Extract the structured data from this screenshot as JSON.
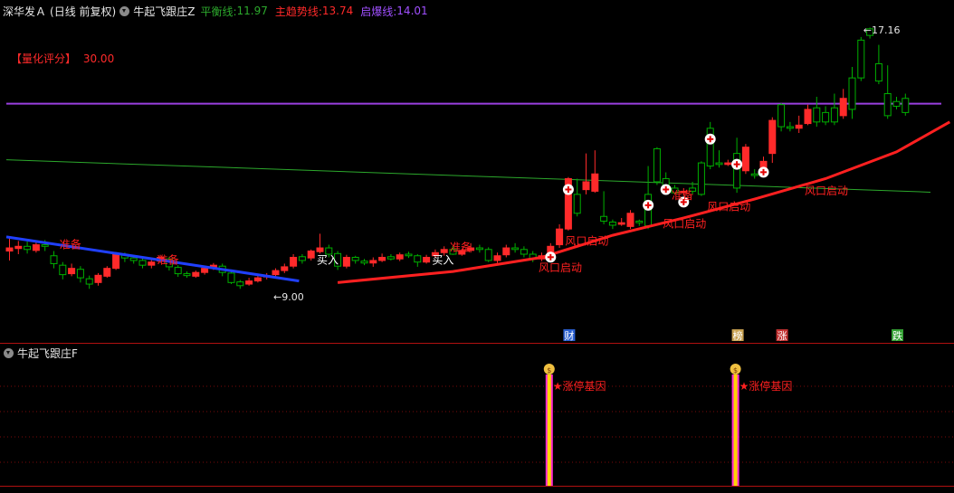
{
  "header": {
    "stock_name": "深华发Ａ",
    "period": "(日线 前复权)",
    "indicator": "牛起飞跟庄Z",
    "ma1_label": "平衡线:",
    "ma1_value": "11.97",
    "ma2_label": "主趋势线:",
    "ma2_value": "13.74",
    "ma3_label": "启爆线:",
    "ma3_value": "14.01"
  },
  "subheader": {
    "indicator": "牛起飞跟庄F"
  },
  "score": {
    "label": "【量化评分】",
    "value": "30.00"
  },
  "chart_data": {
    "type": "candlestick",
    "price_range": [
      7.5,
      17.5
    ],
    "high_label": "17.16",
    "low_label": "9.00",
    "candles": [
      [
        10.1,
        10.2,
        10.5,
        9.8
      ],
      [
        10.18,
        10.25,
        10.42,
        10.0
      ],
      [
        10.25,
        10.15,
        10.4,
        10.02
      ],
      [
        10.12,
        10.3,
        10.4,
        10.05
      ],
      [
        10.3,
        10.25,
        10.45,
        10.1
      ],
      [
        9.95,
        9.7,
        10.1,
        9.55
      ],
      [
        9.65,
        9.35,
        9.75,
        9.2
      ],
      [
        9.38,
        9.55,
        9.7,
        9.3
      ],
      [
        9.52,
        9.25,
        9.62,
        9.1
      ],
      [
        9.22,
        9.05,
        9.32,
        8.9
      ],
      [
        9.1,
        9.33,
        9.4,
        9.0
      ],
      [
        9.3,
        9.55,
        9.62,
        9.25
      ],
      [
        9.55,
        10.02,
        10.05,
        9.5
      ],
      [
        9.98,
        9.88,
        10.05,
        9.75
      ],
      [
        9.88,
        9.8,
        9.95,
        9.7
      ],
      [
        9.8,
        9.65,
        9.9,
        9.55
      ],
      [
        9.65,
        9.75,
        9.86,
        9.55
      ],
      [
        9.78,
        9.9,
        9.98,
        9.72
      ],
      [
        9.85,
        9.6,
        9.92,
        9.48
      ],
      [
        9.58,
        9.38,
        9.65,
        9.28
      ],
      [
        9.38,
        9.32,
        9.45,
        9.25
      ],
      [
        9.3,
        9.42,
        9.48,
        9.25
      ],
      [
        9.42,
        9.55,
        9.62,
        9.35
      ],
      [
        9.58,
        9.65,
        9.72,
        9.5
      ],
      [
        9.62,
        9.42,
        9.7,
        9.3
      ],
      [
        9.4,
        9.1,
        9.48,
        9.05
      ],
      [
        9.12,
        9.0,
        9.18,
        8.9
      ],
      [
        9.05,
        9.15,
        9.25,
        9.0
      ],
      [
        9.15,
        9.25,
        9.35,
        9.1
      ],
      [
        9.28,
        9.32,
        9.4,
        9.2
      ],
      [
        9.35,
        9.48,
        9.55,
        9.3
      ],
      [
        9.48,
        9.6,
        9.7,
        9.4
      ],
      [
        9.62,
        9.9,
        10.0,
        9.55
      ],
      [
        9.92,
        9.8,
        10.0,
        9.7
      ],
      [
        9.88,
        10.1,
        10.15,
        9.8
      ],
      [
        10.08,
        10.2,
        10.65,
        10.02
      ],
      [
        10.2,
        10.0,
        10.3,
        9.9
      ],
      [
        10.02,
        9.62,
        10.1,
        9.5
      ],
      [
        9.62,
        9.9,
        9.98,
        9.55
      ],
      [
        9.9,
        9.8,
        9.95,
        9.7
      ],
      [
        9.78,
        9.72,
        9.85,
        9.65
      ],
      [
        9.72,
        9.8,
        9.9,
        9.6
      ],
      [
        9.8,
        9.9,
        10.02,
        9.75
      ],
      [
        9.92,
        9.85,
        10.0,
        9.8
      ],
      [
        9.85,
        9.98,
        10.05,
        9.78
      ],
      [
        10.0,
        9.95,
        10.08,
        9.88
      ],
      [
        9.95,
        9.75,
        10.0,
        9.6
      ],
      [
        9.75,
        9.9,
        9.98,
        9.7
      ],
      [
        9.95,
        10.05,
        10.15,
        9.88
      ],
      [
        10.05,
        10.15,
        10.25,
        9.95
      ],
      [
        10.15,
        10.0,
        10.28,
        9.98
      ],
      [
        10.0,
        10.12,
        10.18,
        9.95
      ],
      [
        10.12,
        10.2,
        10.35,
        10.05
      ],
      [
        10.2,
        10.15,
        10.3,
        10.05
      ],
      [
        10.15,
        9.8,
        10.22,
        9.75
      ],
      [
        9.8,
        9.95,
        10.05,
        9.72
      ],
      [
        9.98,
        10.2,
        10.3,
        9.9
      ],
      [
        10.2,
        10.15,
        10.35,
        10.05
      ],
      [
        10.15,
        10.0,
        10.25,
        9.9
      ],
      [
        10.0,
        9.85,
        10.1,
        9.75
      ],
      [
        9.85,
        9.95,
        10.05,
        9.78
      ],
      [
        9.95,
        10.25,
        10.35,
        9.9
      ],
      [
        10.3,
        10.8,
        10.95,
        10.2
      ],
      [
        10.8,
        12.4,
        12.45,
        10.75
      ],
      [
        11.9,
        11.3,
        12.4,
        11.2
      ],
      [
        12.05,
        12.3,
        13.2,
        11.9
      ],
      [
        12.0,
        12.55,
        13.3,
        11.95
      ],
      [
        11.2,
        11.05,
        12.0,
        10.95
      ],
      [
        11.02,
        10.92,
        11.1,
        10.8
      ],
      [
        10.95,
        11.0,
        11.15,
        10.9
      ],
      [
        10.88,
        11.3,
        11.4,
        10.8
      ],
      [
        11.05,
        11.0,
        11.1,
        10.9
      ],
      [
        11.9,
        10.9,
        12.8,
        10.8
      ],
      [
        13.35,
        12.3,
        13.4,
        12.2
      ],
      [
        12.4,
        12.2,
        12.6,
        12.1
      ],
      [
        12.1,
        11.95,
        12.2,
        11.9
      ],
      [
        11.95,
        12.0,
        12.1,
        11.85
      ],
      [
        12.1,
        12.0,
        12.3,
        11.9
      ],
      [
        12.9,
        11.9,
        12.95,
        11.85
      ],
      [
        14.0,
        12.8,
        14.2,
        12.7
      ],
      [
        12.9,
        12.85,
        13.3,
        12.75
      ],
      [
        12.85,
        12.9,
        13.0,
        12.8
      ],
      [
        13.2,
        12.1,
        13.7,
        11.95
      ],
      [
        12.65,
        13.4,
        13.5,
        12.55
      ],
      [
        12.55,
        12.5,
        12.7,
        12.4
      ],
      [
        12.5,
        12.95,
        13.1,
        12.45
      ],
      [
        13.2,
        14.25,
        14.35,
        12.9
      ],
      [
        14.75,
        14.05,
        14.8,
        13.9
      ],
      [
        14.05,
        14.0,
        14.2,
        13.9
      ],
      [
        14.0,
        14.1,
        14.4,
        13.85
      ],
      [
        14.15,
        14.6,
        14.75,
        14.1
      ],
      [
        14.65,
        14.2,
        15.0,
        14.05
      ],
      [
        14.5,
        14.2,
        14.7,
        14.1
      ],
      [
        14.65,
        14.2,
        15.1,
        14.1
      ],
      [
        14.4,
        14.95,
        15.25,
        14.3
      ],
      [
        15.6,
        14.6,
        15.95,
        14.3
      ],
      [
        16.8,
        15.6,
        16.9,
        15.5
      ],
      [
        17.16,
        16.95,
        17.2,
        16.85
      ],
      [
        16.05,
        15.5,
        16.65,
        15.4
      ],
      [
        15.1,
        14.4,
        16.0,
        14.3
      ],
      [
        14.85,
        14.7,
        15.0,
        14.6
      ],
      [
        14.95,
        14.5,
        15.1,
        14.4
      ]
    ],
    "ma_levels": {
      "purple": 14.78,
      "green_start": 13.0,
      "green_end": 11.97
    },
    "blue_line": [
      10.55,
      9.15
    ],
    "red_line": [
      [
        37,
        9.1
      ],
      [
        50,
        9.45
      ],
      [
        60,
        9.9
      ],
      [
        68,
        10.6
      ],
      [
        76,
        11.15
      ],
      [
        84,
        11.75
      ],
      [
        92,
        12.4
      ],
      [
        100,
        13.25
      ],
      [
        106,
        14.2
      ]
    ],
    "plus_markers": [
      61,
      63,
      72,
      74,
      76,
      79,
      82,
      85
    ],
    "news_tags": [
      {
        "text": "财",
        "bar": 63,
        "color": "#2a5fd0"
      },
      {
        "text": "榜",
        "bar": 82,
        "color": "#c7a050"
      },
      {
        "text": "涨",
        "bar": 87,
        "color": "#c03030"
      },
      {
        "text": "跌",
        "bar": 100,
        "color": "#33a033"
      }
    ],
    "annotations": [
      {
        "text": "准备",
        "bar": 6,
        "price": 10.18,
        "color": "#ff2020"
      },
      {
        "text": "准备",
        "bar": 17,
        "price": 9.7,
        "color": "#ff2020"
      },
      {
        "text": "买入",
        "bar": 35,
        "price": 9.7,
        "color": "#ffffff"
      },
      {
        "text": "买入",
        "bar": 48,
        "price": 9.7,
        "color": "#ffffff"
      },
      {
        "text": "准备",
        "bar": 50,
        "price": 10.1,
        "color": "#ff2020"
      },
      {
        "text": "风口启动",
        "bar": 60,
        "price": 9.45,
        "color": "#ff2020"
      },
      {
        "text": "风口启动",
        "bar": 63,
        "price": 10.3,
        "color": "#ff2020"
      },
      {
        "text": "风口启动",
        "bar": 74,
        "price": 10.85,
        "color": "#ff2020"
      },
      {
        "text": "准备",
        "bar": 75,
        "price": 11.75,
        "color": "#ff2020"
      },
      {
        "text": "风口启动",
        "bar": 79,
        "price": 11.4,
        "color": "#ff2020"
      },
      {
        "text": "风口启动",
        "bar": 90,
        "price": 11.9,
        "color": "#ff2020"
      }
    ],
    "sub_signals": [
      {
        "bar": 61,
        "label": "涨停基因"
      },
      {
        "bar": 82,
        "label": "涨停基因"
      }
    ]
  },
  "colors": {
    "up": "#ff2a2a",
    "down": "#00b000",
    "ma_purple": "#9a3fe0",
    "ma_green": "#2ca82c",
    "gold": "#ffd300",
    "bg": "#000000"
  }
}
